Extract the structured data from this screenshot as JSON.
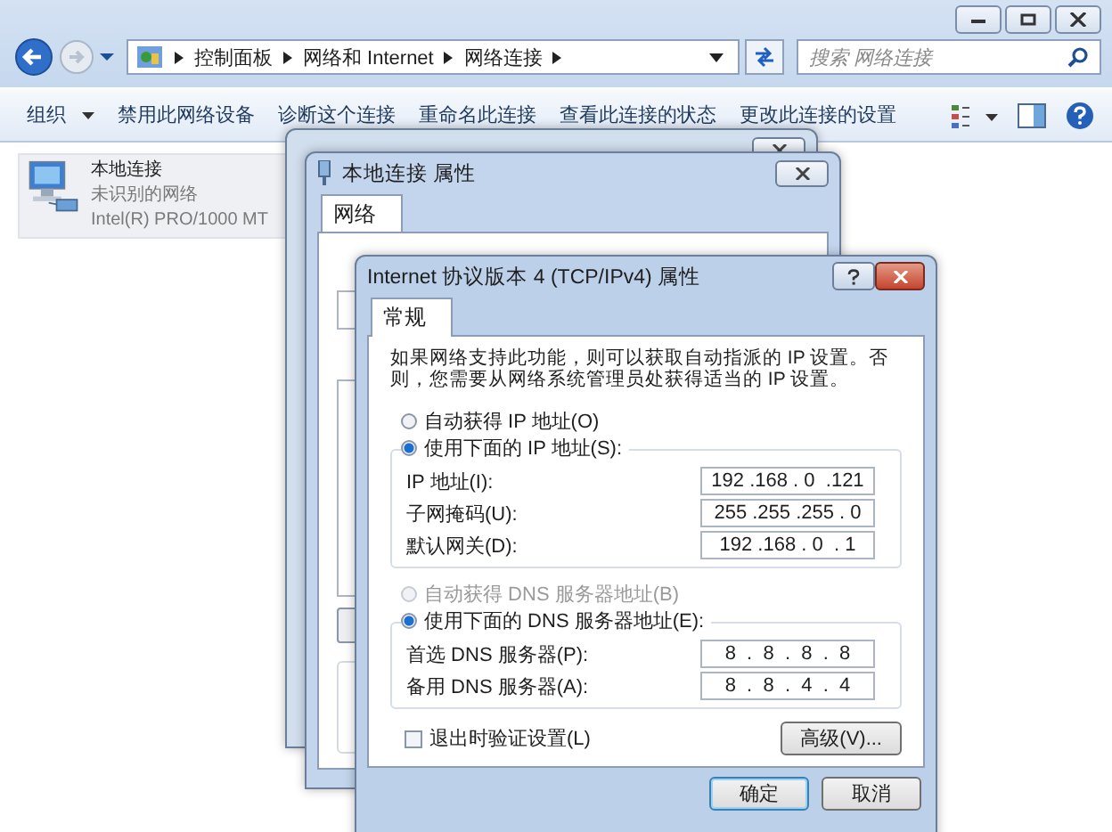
{
  "explorer": {
    "breadcrumbs": [
      "控制面板",
      "网络和 Internet",
      "网络连接"
    ],
    "search": {
      "placeholder": "搜索 网络连接"
    },
    "toolbar": [
      {
        "label": "组织",
        "dropdown": true
      },
      {
        "label": "禁用此网络设备",
        "dropdown": false
      },
      {
        "label": "诊断这个连接",
        "dropdown": false
      },
      {
        "label": "重命名此连接",
        "dropdown": false
      },
      {
        "label": "查看此连接的状态",
        "dropdown": false
      },
      {
        "label": "更改此连接的设置",
        "dropdown": false
      }
    ],
    "connection": {
      "name": "本地连接",
      "status": "未识别的网络",
      "adapter": "Intel(R) PRO/1000 MT"
    }
  },
  "properties_dialog": {
    "title": "本地连接 属性",
    "tab": "网络"
  },
  "ipv4_dialog": {
    "title": "Internet 协议版本 4 (TCP/IPv4) 属性",
    "tab": "常规",
    "description": "如果网络支持此功能，则可以获取自动指派的 IP 设置。否则，您需要从网络系统管理员处获得适当的 IP 设置。",
    "ip_options": [
      {
        "label": "自动获得 IP 地址(O)",
        "selected": false,
        "disabled": false
      },
      {
        "label": "使用下面的 IP 地址(S):",
        "selected": true,
        "disabled": false
      }
    ],
    "ip_fields": [
      {
        "label": "IP 地址(I):",
        "value": "192 .168 . 0  .121"
      },
      {
        "label": "子网掩码(U):",
        "value": "255 .255 .255 . 0"
      },
      {
        "label": "默认网关(D):",
        "value": "192 .168 . 0  . 1"
      }
    ],
    "dns_options": [
      {
        "label": "自动获得 DNS 服务器地址(B)",
        "selected": false,
        "disabled": true
      },
      {
        "label": "使用下面的 DNS 服务器地址(E):",
        "selected": true,
        "disabled": false
      }
    ],
    "dns_fields": [
      {
        "label": "首选 DNS 服务器(P):",
        "value": "8  .  8  .  8  .  8"
      },
      {
        "label": "备用 DNS 服务器(A):",
        "value": "8  .  8  .  4  .  4"
      }
    ],
    "validate": {
      "label": "退出时验证设置(L)",
      "checked": false
    },
    "advanced": "高级(V)...",
    "buttons": [
      "确定",
      "取消"
    ]
  }
}
